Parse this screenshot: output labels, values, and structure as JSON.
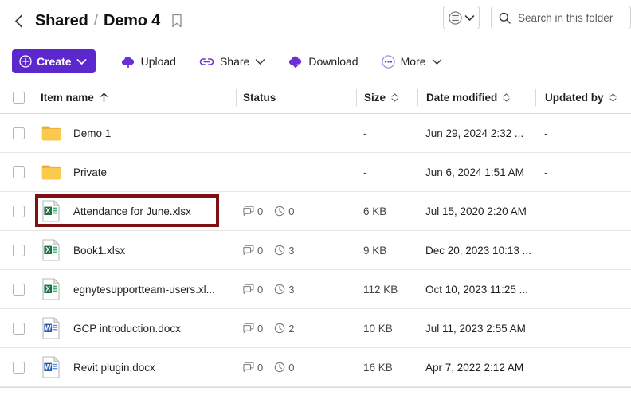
{
  "header": {
    "back_icon": "chevron-left-icon",
    "breadcrumb": {
      "root": "Shared",
      "separator": "/",
      "current": "Demo 4"
    },
    "bookmark_icon": "bookmark-icon",
    "view_toggle": {
      "icon": "list-view-circle-icon",
      "chevron": "chevron-down-icon"
    },
    "search": {
      "icon": "search-icon",
      "placeholder": "Search in this folder"
    }
  },
  "toolbar": {
    "create": {
      "label": "Create",
      "icon": "plus-circle-icon",
      "chevron": "chevron-down-icon"
    },
    "upload": {
      "label": "Upload",
      "icon": "cloud-upload-icon"
    },
    "share": {
      "label": "Share",
      "icon": "link-icon",
      "chevron": "chevron-down-icon"
    },
    "download": {
      "label": "Download",
      "icon": "cloud-download-icon"
    },
    "more": {
      "label": "More",
      "icon": "ellipsis-circle-icon",
      "chevron": "chevron-down-icon"
    },
    "accent_color": "#5c28cd"
  },
  "table": {
    "columns": {
      "item_name": "Item name",
      "status": "Status",
      "size": "Size",
      "date_modified": "Date modified",
      "updated_by": "Updated by"
    },
    "sort": {
      "column": "Item name",
      "direction": "ascending",
      "icon": "arrow-up-icon"
    },
    "rows": [
      {
        "name": "Demo 1",
        "type": "folder",
        "icon": "folder-icon",
        "status": null,
        "size": "-",
        "date_modified": "Jun 29, 2024 2:32 ...",
        "updated_by": "-",
        "highlighted": false
      },
      {
        "name": "Private",
        "type": "folder",
        "icon": "folder-icon",
        "status": null,
        "size": "-",
        "date_modified": "Jun 6, 2024 1:51 AM",
        "updated_by": "-",
        "highlighted": false
      },
      {
        "name": "Attendance for June.xlsx",
        "type": "excel",
        "icon": "excel-file-icon",
        "status": {
          "comments": "0",
          "versions": "0"
        },
        "size": "6 KB",
        "date_modified": "Jul 15, 2020 2:20 AM",
        "updated_by": "",
        "highlighted": true
      },
      {
        "name": "Book1.xlsx",
        "type": "excel",
        "icon": "excel-file-icon",
        "status": {
          "comments": "0",
          "versions": "3"
        },
        "size": "9 KB",
        "date_modified": "Dec 20, 2023 10:13 ...",
        "updated_by": "",
        "highlighted": false
      },
      {
        "name": "egnytesupportteam-users.xl...",
        "type": "excel",
        "icon": "excel-file-icon",
        "status": {
          "comments": "0",
          "versions": "3"
        },
        "size": "112 KB",
        "date_modified": "Oct 10, 2023 11:25 ...",
        "updated_by": "",
        "highlighted": false
      },
      {
        "name": "GCP introduction.docx",
        "type": "word",
        "icon": "word-file-icon",
        "status": {
          "comments": "0",
          "versions": "2"
        },
        "size": "10 KB",
        "date_modified": "Jul 11, 2023 2:55 AM",
        "updated_by": "",
        "highlighted": false
      },
      {
        "name": "Revit plugin.docx",
        "type": "word",
        "icon": "word-file-icon",
        "status": {
          "comments": "0",
          "versions": "0"
        },
        "size": "16 KB",
        "date_modified": "Apr 7, 2022 2:12 AM",
        "updated_by": "",
        "highlighted": false
      }
    ],
    "status_icons": {
      "comments": "comment-bubble-icon",
      "versions": "clock-icon"
    },
    "highlight_color": "#7d1114"
  }
}
